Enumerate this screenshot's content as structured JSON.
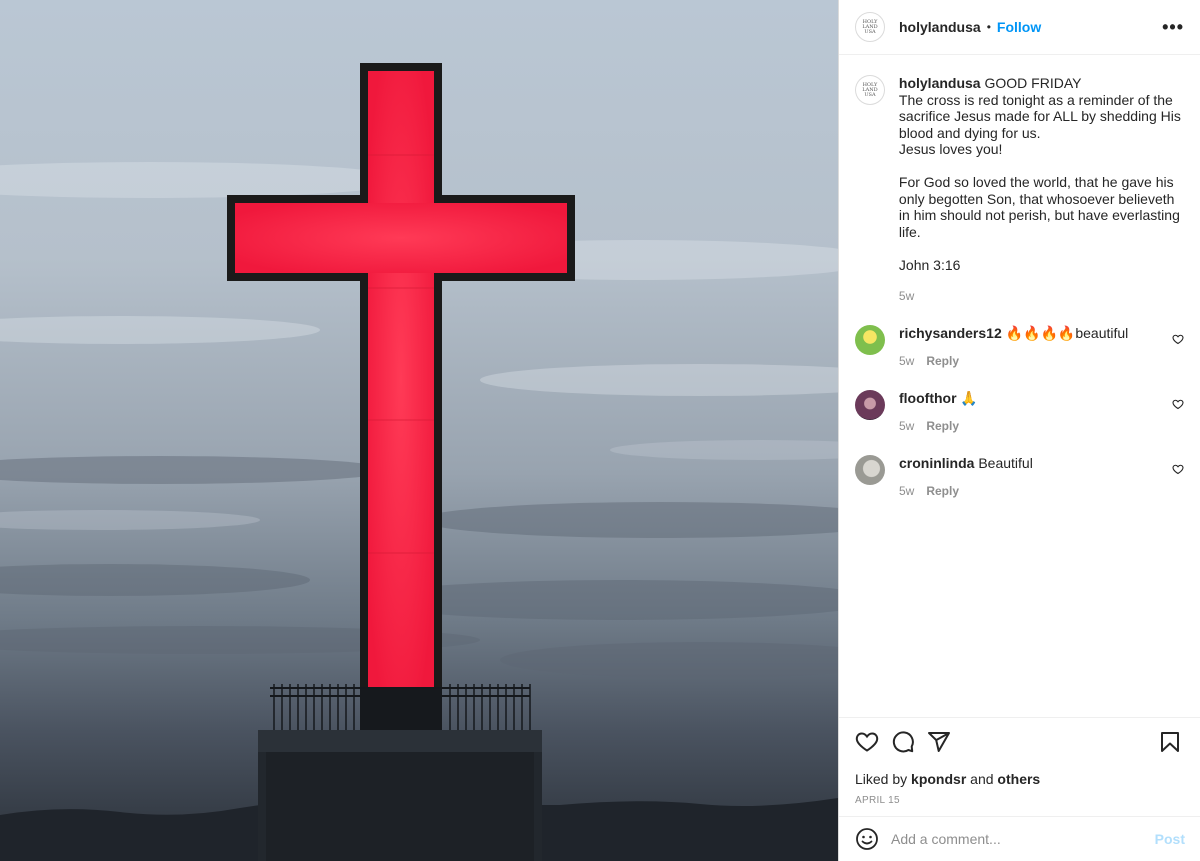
{
  "post": {
    "username": "holylandusa",
    "dot": "•",
    "follow_label": "Follow",
    "more_icon": "more-horizontal-icon",
    "avatar_text": "HOLY LAND USA"
  },
  "caption": {
    "username": "holylandusa",
    "text": "GOOD FRIDAY\nThe cross is red tonight as a reminder of the sacrifice Jesus made for ALL by shedding His blood and dying for us.\nJesus loves you!\n\nFor God so loved the world, that he gave his only begotten Son, that whosoever believeth in him should not perish, but have everlasting life.\n\nJohn 3:16",
    "time": "5w"
  },
  "comments": [
    {
      "username": "richysanders12",
      "text": "🔥🔥🔥🔥beautiful",
      "time": "5w",
      "reply_label": "Reply",
      "avatar_color": "#7fbf4d"
    },
    {
      "username": "floofthor",
      "text": "🙏",
      "time": "5w",
      "reply_label": "Reply",
      "avatar_color": "#6b3a5a"
    },
    {
      "username": "croninlinda",
      "text": "Beautiful",
      "time": "5w",
      "reply_label": "Reply",
      "avatar_color": "#9a9a94"
    }
  ],
  "actions": {
    "liked_prefix": "Liked by",
    "liked_user": "kpondsr",
    "liked_and": "and",
    "liked_others": "others",
    "date": "APRIL 15"
  },
  "add_comment": {
    "placeholder": "Add a comment...",
    "post_label": "Post"
  },
  "colors": {
    "cross": "#ff2a4a",
    "follow": "#0095f6",
    "post_disabled": "#b2dffc"
  }
}
